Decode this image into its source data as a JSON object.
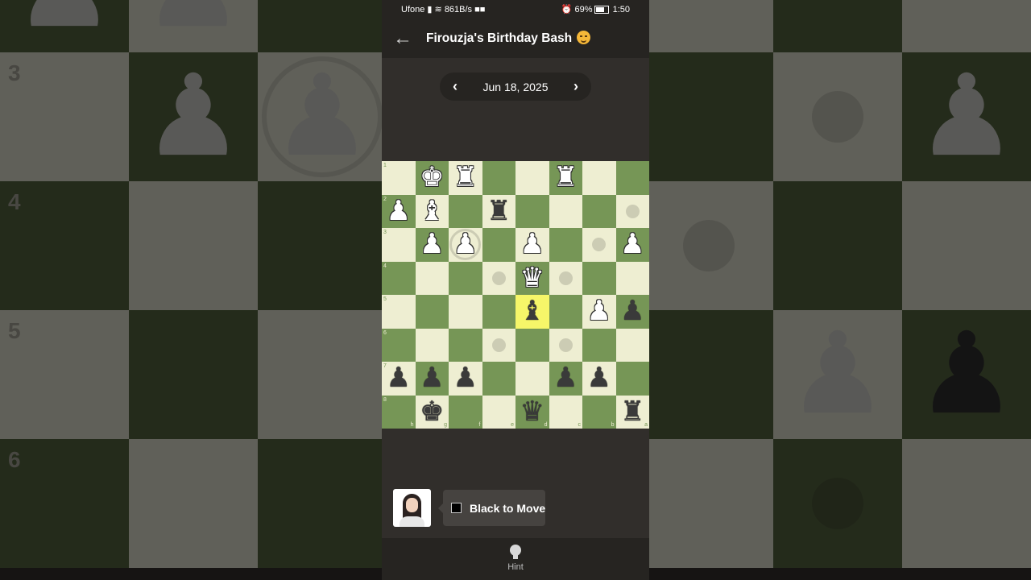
{
  "status_bar": {
    "carrier": "Ufone",
    "speed": "861B/s",
    "battery": "69%",
    "time": "1:50"
  },
  "header": {
    "title": "Firouzja's Birthday Bash",
    "back_icon": "arrow-left-icon",
    "emoji": "party-face"
  },
  "date_nav": {
    "date": "Jun 18, 2025",
    "prev_icon": "chevron-left-icon",
    "next_icon": "chevron-right-icon"
  },
  "board": {
    "orientation": "black-bottom",
    "rank_labels": [
      "1",
      "2",
      "3",
      "4",
      "5",
      "6",
      "7",
      "8"
    ],
    "file_labels": [
      "h",
      "g",
      "f",
      "e",
      "d",
      "c",
      "b",
      "a"
    ],
    "colors": {
      "light": "#eeeed2",
      "dark": "#769656",
      "highlight": "#f6f669"
    },
    "pieces": [
      {
        "square": "g1",
        "piece": "white-king"
      },
      {
        "square": "f1",
        "piece": "white-rook"
      },
      {
        "square": "c1",
        "piece": "white-rook"
      },
      {
        "square": "h2",
        "piece": "white-pawn"
      },
      {
        "square": "g2",
        "piece": "white-bishop"
      },
      {
        "square": "e2",
        "piece": "black-rook"
      },
      {
        "square": "g3",
        "piece": "white-pawn"
      },
      {
        "square": "f3",
        "piece": "white-pawn"
      },
      {
        "square": "d3",
        "piece": "white-pawn"
      },
      {
        "square": "a3",
        "piece": "white-pawn"
      },
      {
        "square": "d4",
        "piece": "white-queen"
      },
      {
        "square": "d5",
        "piece": "black-bishop"
      },
      {
        "square": "b5",
        "piece": "white-pawn"
      },
      {
        "square": "a5",
        "piece": "black-pawn"
      },
      {
        "square": "h7",
        "piece": "black-pawn"
      },
      {
        "square": "g7",
        "piece": "black-pawn"
      },
      {
        "square": "f7",
        "piece": "black-pawn"
      },
      {
        "square": "c7",
        "piece": "black-pawn"
      },
      {
        "square": "b7",
        "piece": "black-pawn"
      },
      {
        "square": "g8",
        "piece": "black-king"
      },
      {
        "square": "d8",
        "piece": "black-queen"
      },
      {
        "square": "a8",
        "piece": "black-rook"
      }
    ],
    "highlighted": [
      "d5"
    ],
    "move_dots": [
      "a2",
      "b3",
      "e4",
      "c4",
      "e6",
      "c6"
    ],
    "capture_rings": [
      "f3"
    ]
  },
  "move_info": {
    "avatar_icon": "coach-avatar",
    "side_icon": "black-square-icon",
    "text": "Black to Move"
  },
  "footer": {
    "hint_label": "Hint",
    "hint_icon": "lightbulb-icon"
  }
}
